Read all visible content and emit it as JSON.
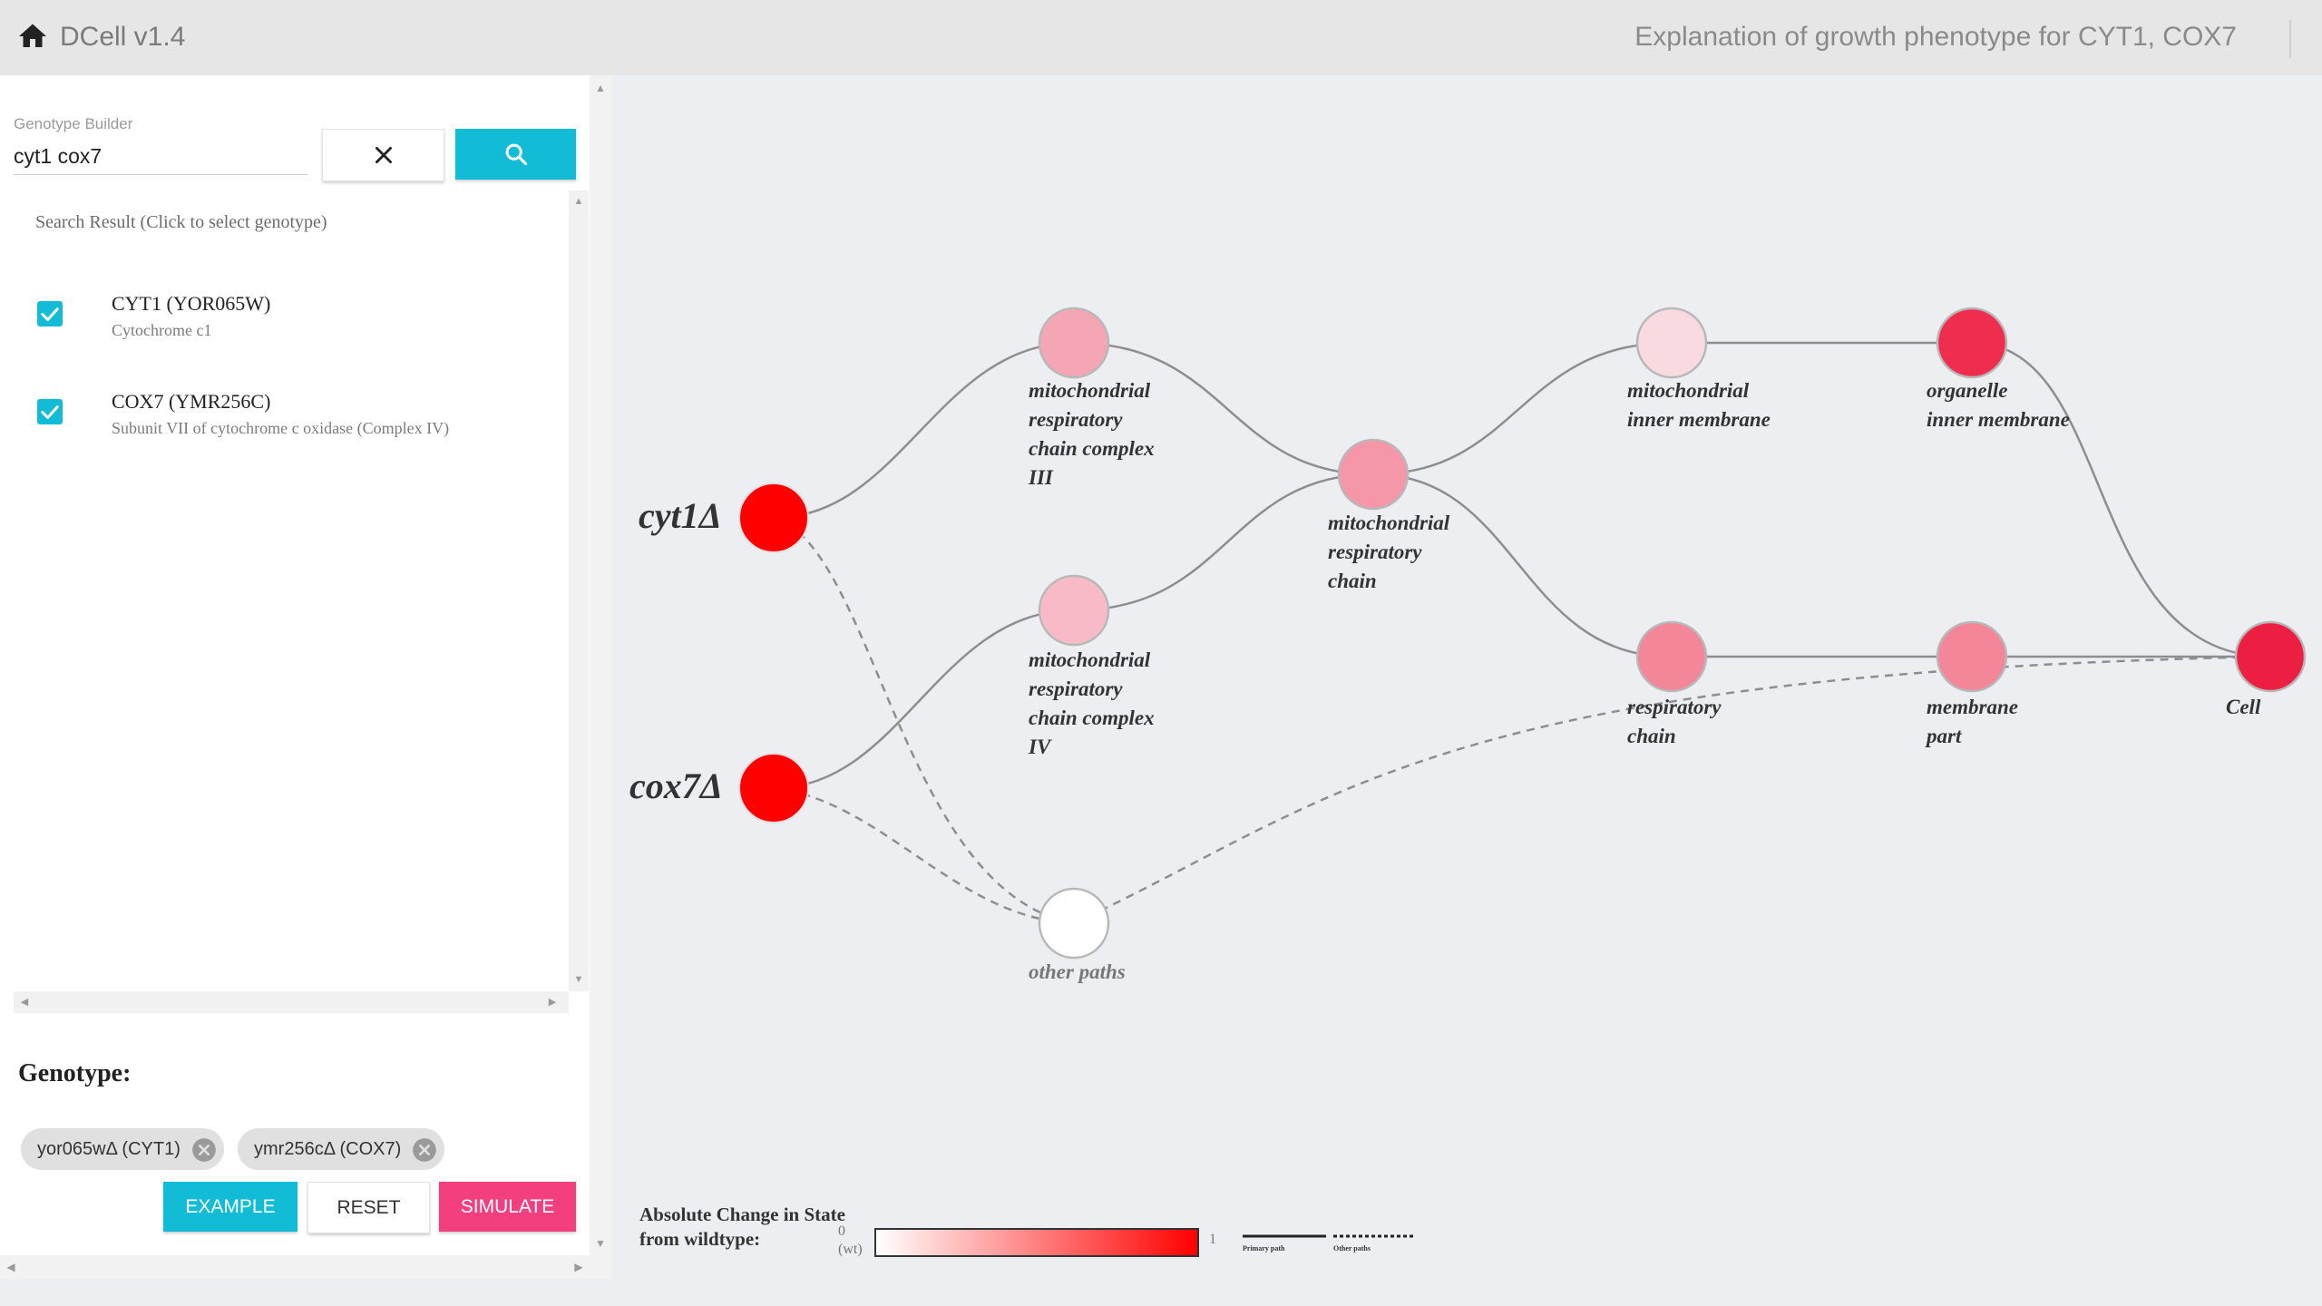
{
  "app": {
    "title": "DCell v1.4",
    "page_heading": "Explanation of growth phenotype for CYT1, COX7"
  },
  "genotype_builder": {
    "label": "Genotype Builder",
    "query": "cyt1 cox7",
    "clear_icon": "close-icon",
    "search_icon": "search-icon",
    "accent_color": "#12bcd6"
  },
  "search_results": {
    "header": "Search Result (Click to select genotype)",
    "items": [
      {
        "name": "CYT1 (YOR065W)",
        "description": "Cytochrome c1",
        "checked": true
      },
      {
        "name": "COX7 (YMR256C)",
        "description": "Subunit VII of cytochrome c oxidase (Complex IV)",
        "checked": true
      }
    ]
  },
  "genotype": {
    "title": "Genotype:",
    "chips": [
      "yor065wΔ (CYT1)",
      "ymr256cΔ (COX7)"
    ]
  },
  "actions": {
    "example": "EXAMPLE",
    "reset": "RESET",
    "simulate": "SIMULATE",
    "simulate_color": "#f43f7e"
  },
  "graph": {
    "genes": [
      "cyt1Δ",
      "cox7Δ"
    ],
    "nodes": [
      {
        "label": "mitochondrial\nrespiratory\nchain complex\nIII",
        "state": 0.35
      },
      {
        "label": "mitochondrial\nrespiratory\nchain complex\nIV",
        "state": 0.28
      },
      {
        "label": "mitochondrial\nrespiratory\nchain",
        "state": 0.42
      },
      {
        "label": "mitochondrial\ninner membrane",
        "state": 0.18
      },
      {
        "label": "organelle\ninner membrane",
        "state": 0.85
      },
      {
        "label": "respiratory\nchain",
        "state": 0.5
      },
      {
        "label": "membrane\npart",
        "state": 0.5
      },
      {
        "label": "Cell",
        "state": 0.88
      },
      {
        "label": "other paths",
        "state": 0.0
      }
    ]
  },
  "legend": {
    "title": "Absolute Change in State from wildtype:",
    "min": "0\n(wt)",
    "max": "1",
    "primary_label": "Primary path",
    "other_label": "Other paths",
    "gradient_start": "#ffffff",
    "gradient_end": "#ff0000"
  }
}
